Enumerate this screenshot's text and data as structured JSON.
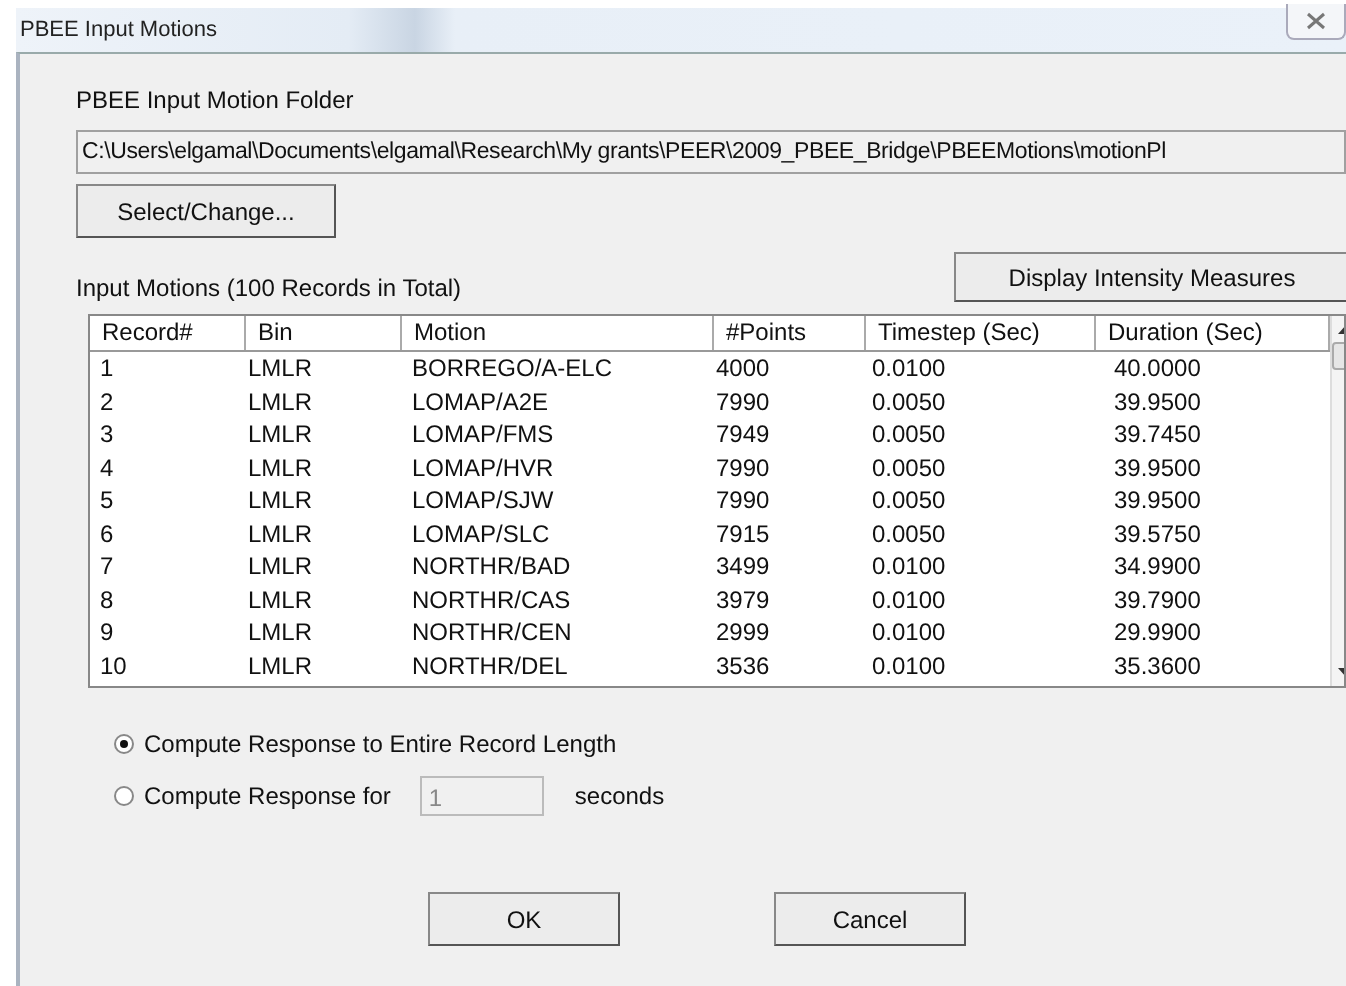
{
  "window": {
    "title": "PBEE Input Motions"
  },
  "folder": {
    "label": "PBEE Input Motion Folder",
    "value": "C:\\Users\\elgamal\\Documents\\elgamal\\Research\\My grants\\PEER\\2009_PBEE_Bridge\\PBEEMotions\\motionPl",
    "button": "Select/Change..."
  },
  "motions": {
    "label": "Input Motions (100 Records in Total)",
    "button": "Display Intensity Measures",
    "columns": [
      "Record#",
      "Bin",
      "Motion",
      "#Points",
      "Timestep (Sec)",
      "Duration (Sec)"
    ],
    "rows": [
      [
        "1",
        "LMLR",
        "BORREGO/A-ELC",
        "4000",
        "0.0100",
        "40.0000"
      ],
      [
        "2",
        "LMLR",
        "LOMAP/A2E",
        "7990",
        "0.0050",
        "39.9500"
      ],
      [
        "3",
        "LMLR",
        "LOMAP/FMS",
        "7949",
        "0.0050",
        "39.7450"
      ],
      [
        "4",
        "LMLR",
        "LOMAP/HVR",
        "7990",
        "0.0050",
        "39.9500"
      ],
      [
        "5",
        "LMLR",
        "LOMAP/SJW",
        "7990",
        "0.0050",
        "39.9500"
      ],
      [
        "6",
        "LMLR",
        "LOMAP/SLC",
        "7915",
        "0.0050",
        "39.5750"
      ],
      [
        "7",
        "LMLR",
        "NORTHR/BAD",
        "3499",
        "0.0100",
        "34.9900"
      ],
      [
        "8",
        "LMLR",
        "NORTHR/CAS",
        "3979",
        "0.0100",
        "39.7900"
      ],
      [
        "9",
        "LMLR",
        "NORTHR/CEN",
        "2999",
        "0.0100",
        "29.9900"
      ],
      [
        "10",
        "LMLR",
        "NORTHR/DEL",
        "3536",
        "0.0100",
        "35.3600"
      ]
    ]
  },
  "options": [
    {
      "kind": "plain",
      "label": "Compute Response to Entire Record Length",
      "selected": true
    },
    {
      "kind": "duration",
      "label": "Compute Response for",
      "value": "1",
      "unit": "seconds",
      "selected": false
    }
  ],
  "buttons": [
    "OK",
    "Cancel"
  ]
}
